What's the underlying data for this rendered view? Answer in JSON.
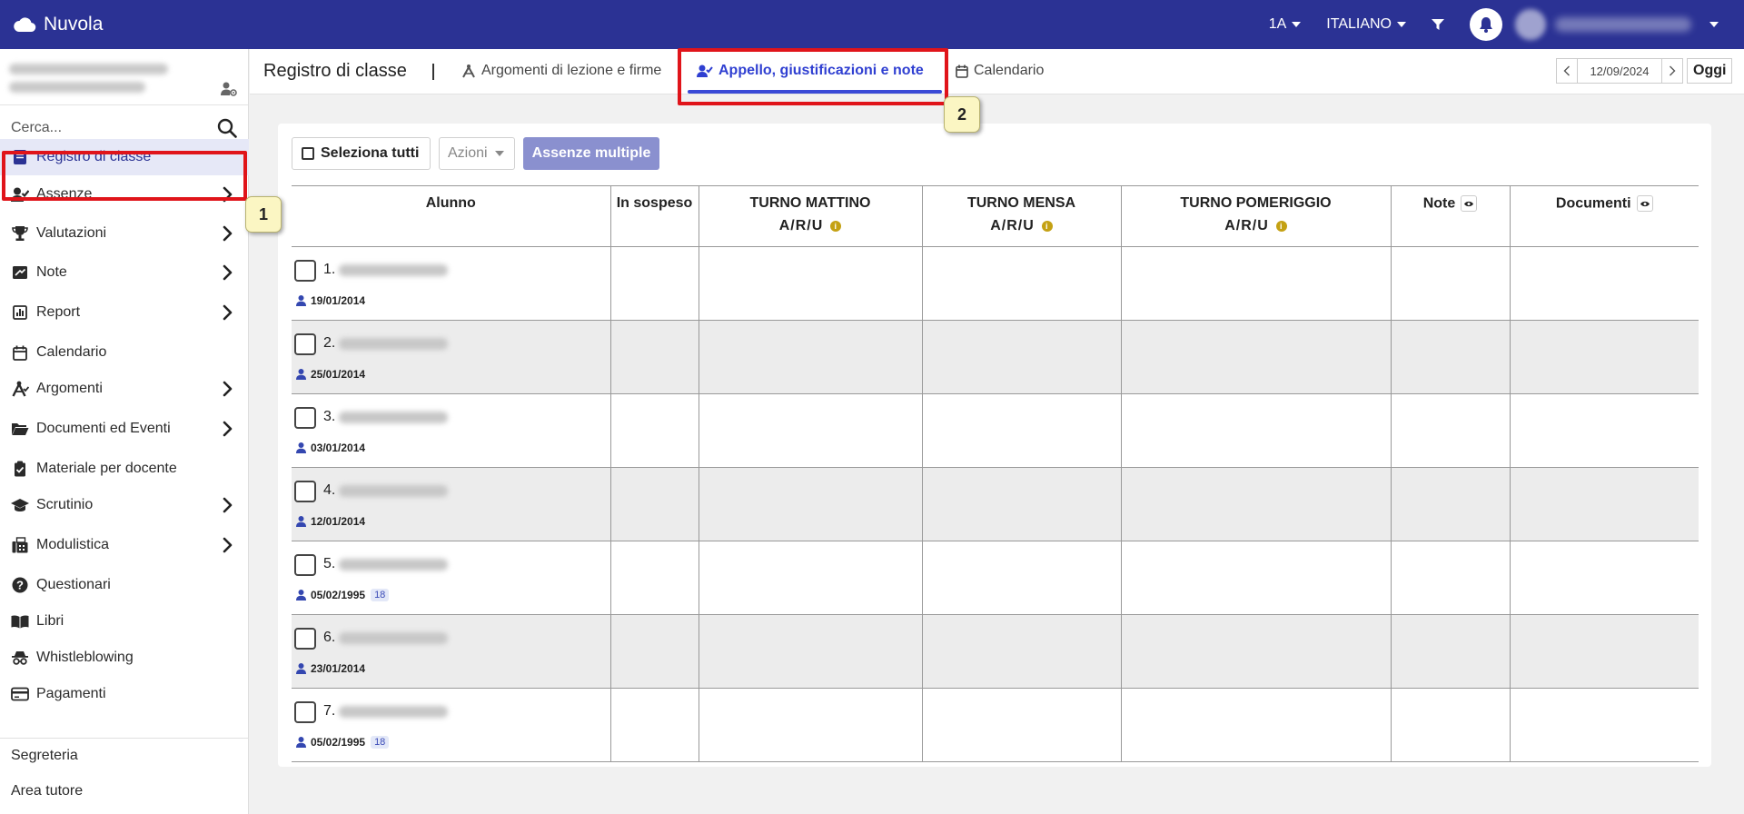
{
  "app": {
    "name": "Nuvola"
  },
  "topbar": {
    "class_selector": "1A",
    "language": "ITALIANO"
  },
  "sidebar": {
    "search_placeholder": "Cerca...",
    "items": [
      {
        "label": "Registro di classe",
        "icon": "book-icon",
        "chevron": false,
        "active": true
      },
      {
        "label": "Assenze",
        "icon": "user-check-icon",
        "chevron": true
      },
      {
        "label": "Valutazioni",
        "icon": "trophy-icon",
        "chevron": true
      },
      {
        "label": "Note",
        "icon": "note-icon",
        "chevron": true
      },
      {
        "label": "Report",
        "icon": "chart-icon",
        "chevron": true
      },
      {
        "label": "Calendario",
        "icon": "calendar-icon",
        "chevron": false
      },
      {
        "label": "Argomenti",
        "icon": "compass-icon",
        "chevron": true
      },
      {
        "label": "Documenti ed Eventi",
        "icon": "folder-icon",
        "chevron": true
      },
      {
        "label": "Materiale per docente",
        "icon": "clipboard-icon",
        "chevron": false
      },
      {
        "label": "Scrutinio",
        "icon": "graduation-cap-icon",
        "chevron": true
      },
      {
        "label": "Modulistica",
        "icon": "fax-icon",
        "chevron": true
      },
      {
        "label": "Questionari",
        "icon": "question-icon",
        "chevron": false
      },
      {
        "label": "Libri",
        "icon": "open-book-icon",
        "chevron": false
      },
      {
        "label": "Whistleblowing",
        "icon": "spy-icon",
        "chevron": false
      },
      {
        "label": "Pagamenti",
        "icon": "credit-card-icon",
        "chevron": false
      }
    ],
    "footer_links": [
      "Segreteria",
      "Area tutore"
    ]
  },
  "header": {
    "title": "Registro di classe",
    "tabs": [
      {
        "label": "Argomenti di lezione e firme",
        "icon": "compass-icon"
      },
      {
        "label": "Appello, giustificazioni e note",
        "icon": "user-check-icon",
        "active": true
      },
      {
        "label": "Calendario",
        "icon": "calendar-icon"
      }
    ],
    "date": "12/09/2024",
    "today_label": "Oggi"
  },
  "toolbar": {
    "select_all": "Seleziona tutti",
    "actions": "Azioni",
    "multiple_absences": "Assenze multiple"
  },
  "table": {
    "columns": {
      "student": "Alunno",
      "suspended": "In sospeso",
      "morning": "TURNO MATTINO",
      "canteen": "TURNO MENSA",
      "afternoon": "TURNO POMERIGGIO",
      "shift_sub": "A/R/U",
      "notes": "Note",
      "documents": "Documenti"
    },
    "rows": [
      {
        "num": "1.",
        "dob": "19/01/2014",
        "age": ""
      },
      {
        "num": "2.",
        "dob": "25/01/2014",
        "age": ""
      },
      {
        "num": "3.",
        "dob": "03/01/2014",
        "age": ""
      },
      {
        "num": "4.",
        "dob": "12/01/2014",
        "age": ""
      },
      {
        "num": "5.",
        "dob": "05/02/1995",
        "age": "18"
      },
      {
        "num": "6.",
        "dob": "23/01/2014",
        "age": ""
      },
      {
        "num": "7.",
        "dob": "05/02/1995",
        "age": "18"
      }
    ]
  },
  "callouts": [
    "1",
    "2"
  ],
  "colors": {
    "topbar": "#2b3294",
    "accent": "#2f3fd1",
    "highlight": "#e0141a",
    "callout_bg": "#fbf6c3"
  }
}
